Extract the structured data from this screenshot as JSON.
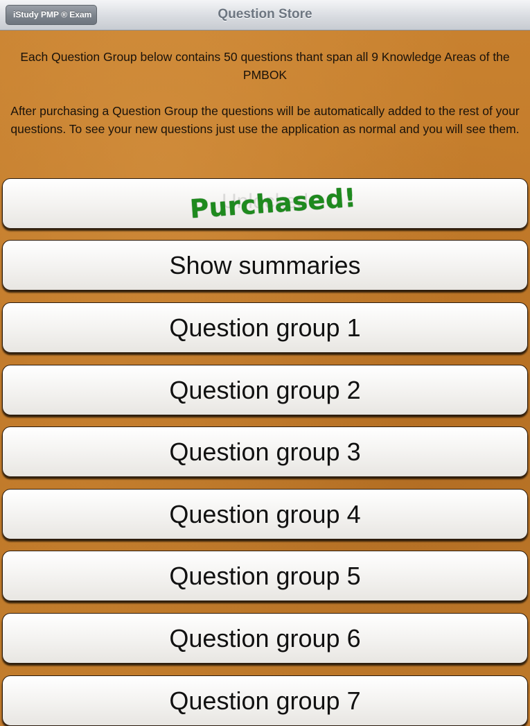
{
  "navbar": {
    "back_label": "iStudy PMP ® Exam",
    "title": "Question Store"
  },
  "intro": {
    "paragraph_1": "Each Question Group below contains 50 questions thant span all 9 Knowledge Areas of the PMBOK",
    "paragraph_2": "After purchasing a Question Group the questions will be automatically added to the rest of your questions. To see your new questions just use the application as normal and you will see them."
  },
  "purchased_row": {
    "ghost_label": "Unlocked",
    "stamp": "Purchased!"
  },
  "rows": [
    {
      "label": "Show summaries"
    },
    {
      "label": "Question group 1"
    },
    {
      "label": "Question group 2"
    },
    {
      "label": "Question group 3"
    },
    {
      "label": "Question group 4"
    },
    {
      "label": "Question group 5"
    },
    {
      "label": "Question group 6"
    },
    {
      "label": "Question group 7"
    }
  ],
  "colors": {
    "background": "#c27a2c",
    "stamp_green": "#1e8a1e"
  }
}
